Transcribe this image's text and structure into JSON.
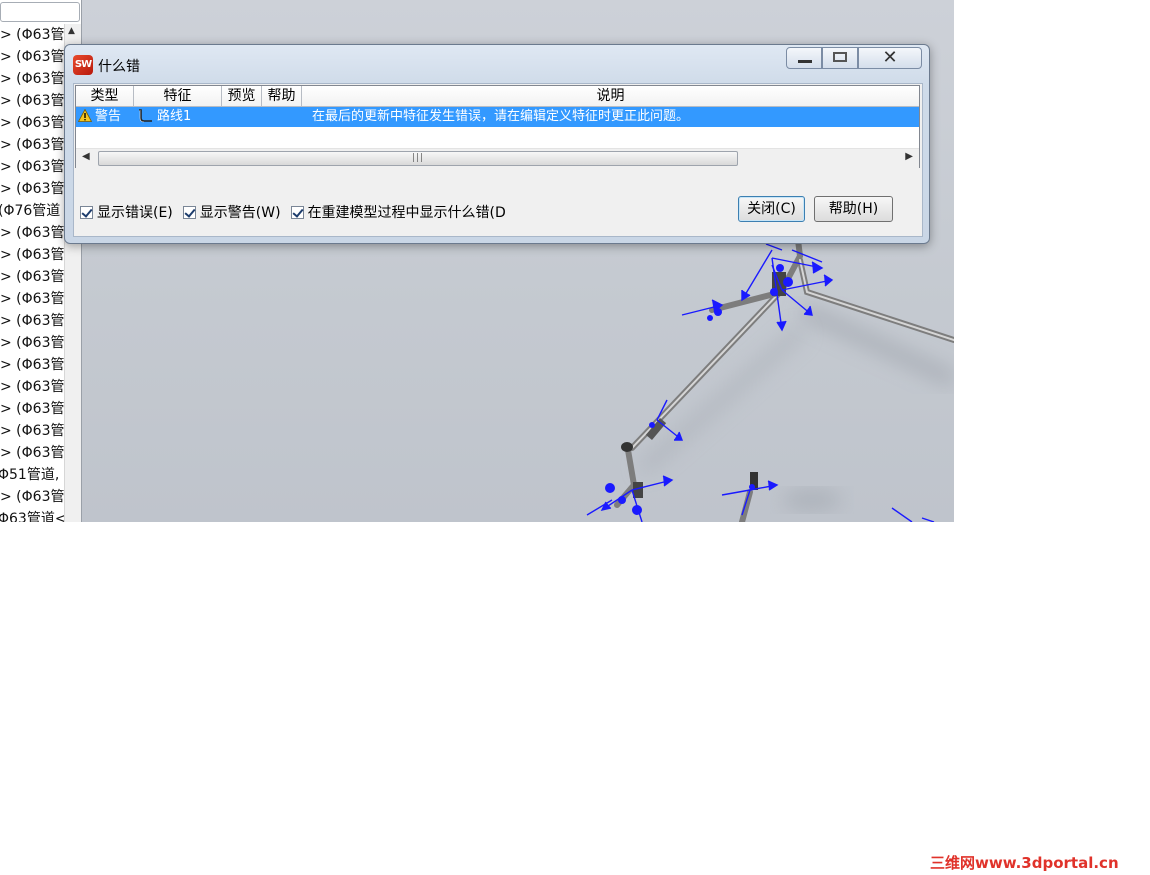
{
  "tree": {
    "rows": [
      "> (Φ63管",
      "> (Φ63管",
      "> (Φ63管",
      "> (Φ63管",
      "> (Φ63管",
      "> (Φ63管",
      "> (Φ63管",
      "> (Φ63管",
      "(Φ76管道",
      "> (Φ63管",
      "> (Φ63管",
      "> (Φ63管",
      "> (Φ63管",
      "> (Φ63管",
      "> (Φ63管",
      "> (Φ63管",
      "> (Φ63管",
      "> (Φ63管",
      "> (Φ63管",
      "> (Φ63管",
      "Φ51管道, -",
      "> (Φ63管",
      "Φ63管道<"
    ]
  },
  "dialog": {
    "title": "什么错",
    "columns": [
      "类型",
      "特征",
      "预览",
      "帮助",
      "说明"
    ],
    "rows": [
      {
        "type": "警告",
        "feature": "路线1",
        "preview": "",
        "help": "",
        "description": "在最后的更新中特征发生错误，请在编辑定义特征时更正此问题。"
      }
    ],
    "checkboxes": [
      {
        "label": "显示错误(E)",
        "checked": true
      },
      {
        "label": "显示警告(W)",
        "checked": true
      },
      {
        "label": "在重建模型过程中显示什么错(D",
        "checked": true
      }
    ],
    "buttons": {
      "close": "关闭(C)",
      "help": "帮助(H)"
    }
  },
  "watermark": "三维网www.3dportal.cn",
  "colors": {
    "selection": "#3399ff",
    "viewport": "#c7ccd3",
    "pipe": "#8c8c8c",
    "marker": "#1a1aff",
    "watermark": "#e0322a"
  }
}
